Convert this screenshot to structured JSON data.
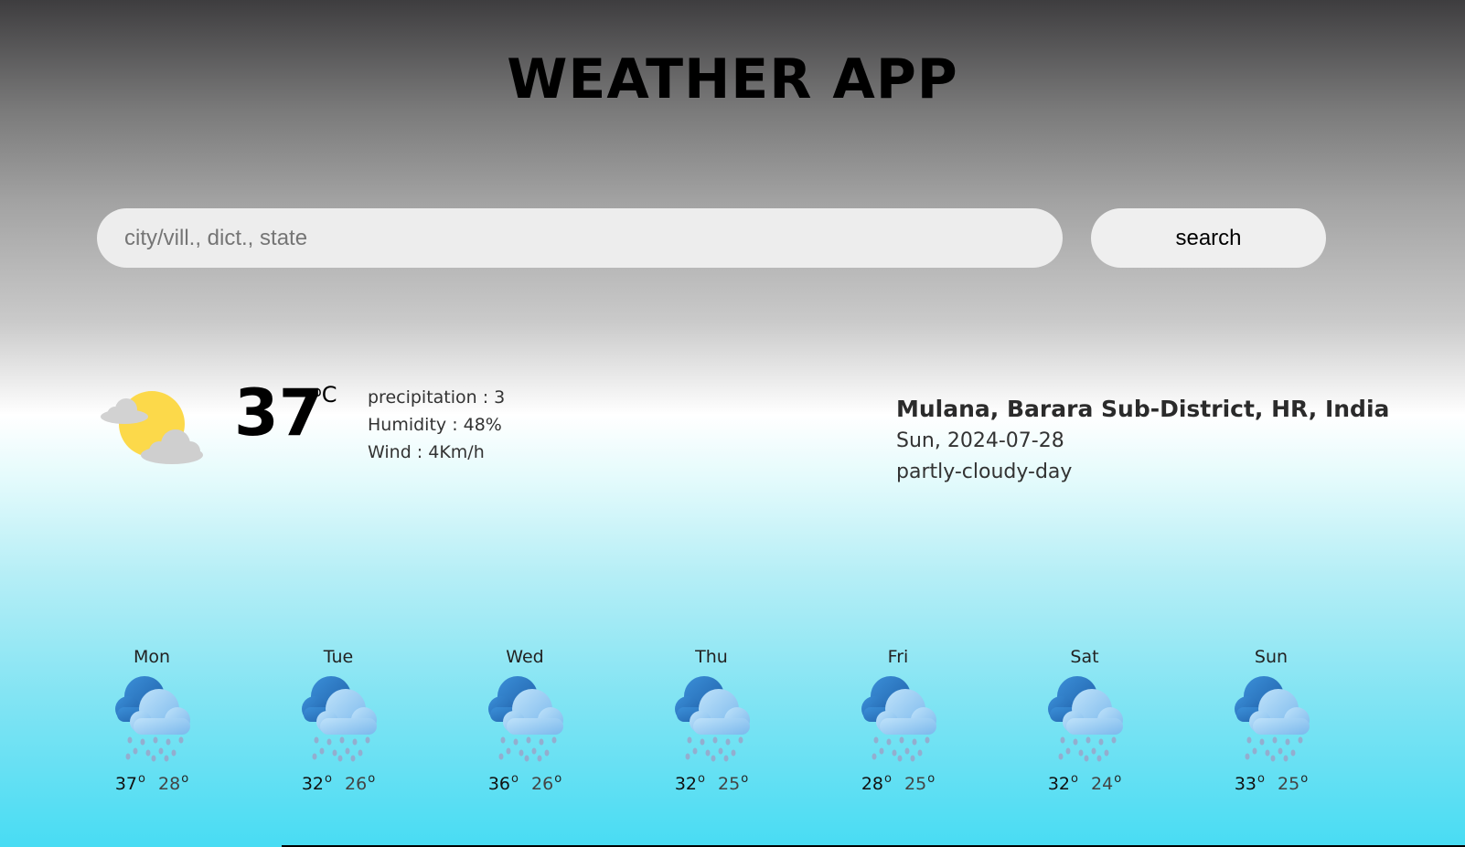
{
  "app": {
    "title": "WEATHER APP"
  },
  "search": {
    "placeholder": "city/vill., dict., state",
    "value": "",
    "button_label": "search"
  },
  "current": {
    "icon": "partly-cloudy-day-icon",
    "temperature": "37",
    "unit_degree": "o",
    "unit_letter": "C",
    "precipitation": "precipitation : 3",
    "humidity": "Humidity : 48%",
    "wind": "Wind : 4Km/h",
    "location": "Mulana, Barara Sub-District, HR, India",
    "date": "Sun, 2024-07-28",
    "condition": "partly-cloudy-day"
  },
  "forecast": [
    {
      "day": "Mon",
      "max": "37",
      "min": "28",
      "icon": "rain-cloud-icon"
    },
    {
      "day": "Tue",
      "max": "32",
      "min": "26",
      "icon": "rain-cloud-icon"
    },
    {
      "day": "Wed",
      "max": "36",
      "min": "26",
      "icon": "rain-cloud-icon"
    },
    {
      "day": "Thu",
      "max": "32",
      "min": "25",
      "icon": "rain-cloud-icon"
    },
    {
      "day": "Fri",
      "max": "28",
      "min": "25",
      "icon": "rain-cloud-icon"
    },
    {
      "day": "Sat",
      "max": "32",
      "min": "24",
      "icon": "rain-cloud-icon"
    },
    {
      "day": "Sun",
      "max": "33",
      "min": "25",
      "icon": "rain-cloud-icon"
    }
  ],
  "degree_symbol": "o",
  "colors": {
    "sun": "#fcd94a",
    "cloud": "#d3d3d3",
    "rain_cloud_dark": "#2f7fd0",
    "rain_cloud_light": "#9fd0f5"
  }
}
